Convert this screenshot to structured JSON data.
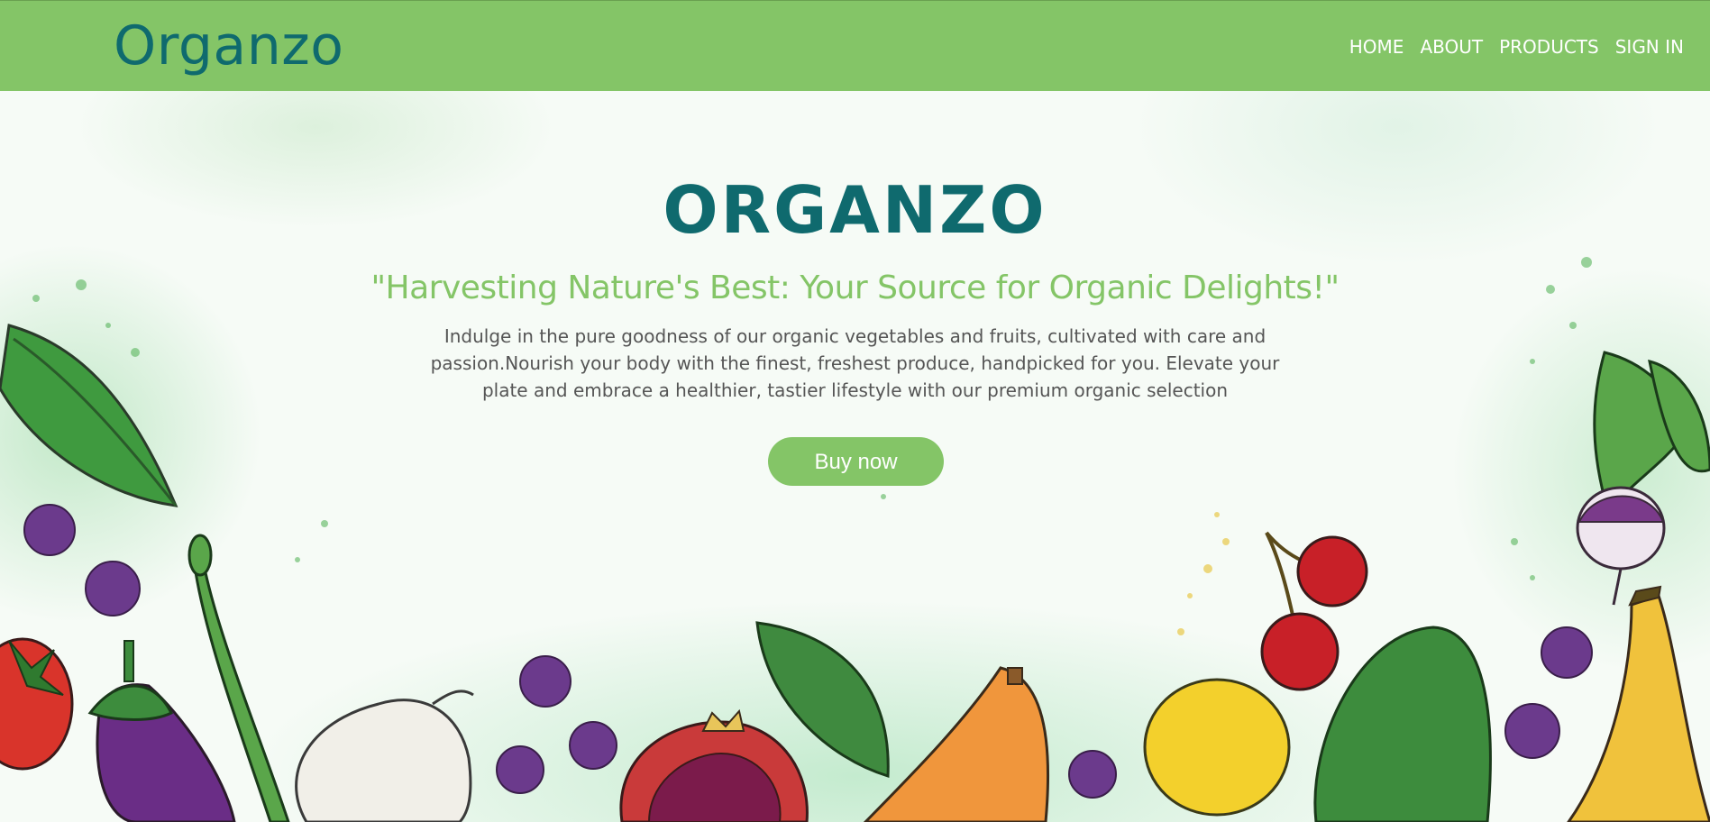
{
  "header": {
    "logo": "Organzo",
    "nav": [
      {
        "label": "HOME"
      },
      {
        "label": "ABOUT"
      },
      {
        "label": "PRODUCTS"
      },
      {
        "label": "SIGN IN"
      }
    ]
  },
  "hero": {
    "title": "ORGANZO",
    "tagline": "\"Harvesting Nature's Best: Your Source for Organic Delights!\"",
    "description": "Indulge in the pure goodness of our organic vegetables and fruits, cultivated with care and passion.Nourish your body with the finest, freshest produce, handpicked for you. Elevate your plate and embrace a healthier, tastier lifestyle with our premium organic selection",
    "button_label": "Buy now",
    "illustration_items": [
      "leaf-icon",
      "blackberry-icon",
      "tomato-icon",
      "eggplant-icon",
      "asparagus-icon",
      "garlic-icon",
      "pomegranate-icon",
      "papaya-icon",
      "lemon-icon",
      "cherry-icon",
      "avocado-icon",
      "turnip-icon",
      "banana-icon"
    ]
  },
  "colors": {
    "header_bg": "#84c567",
    "logo": "#0f6a6e",
    "title": "#0f6a6e",
    "tagline": "#84c567",
    "description": "#555555",
    "button_bg": "#84c567",
    "button_text": "#ffffff"
  }
}
